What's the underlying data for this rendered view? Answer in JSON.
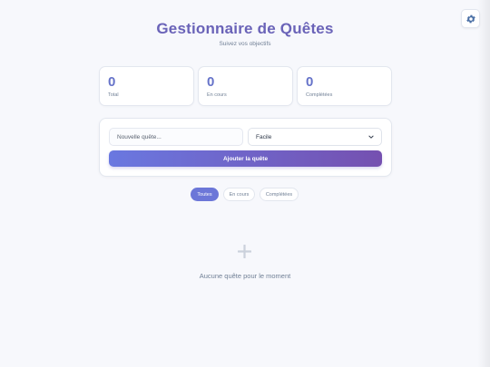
{
  "header": {
    "title": "Gestionnaire de Quêtes",
    "subtitle": "Suivez vos objectifs"
  },
  "settings": {
    "icon": "gear-icon"
  },
  "stats": [
    {
      "value": "0",
      "label": "Total"
    },
    {
      "value": "0",
      "label": "En cours"
    },
    {
      "value": "0",
      "label": "Complétées"
    }
  ],
  "form": {
    "input_placeholder": "Nouvelle quête...",
    "input_value": "",
    "difficulty_selected": "Facile",
    "add_button_label": "Ajouter la quête"
  },
  "filters": [
    {
      "label": "Toutes",
      "active": true
    },
    {
      "label": "En cours",
      "active": false
    },
    {
      "label": "Complétées",
      "active": false
    }
  ],
  "empty_state": {
    "icon": "plus-icon",
    "text": "Aucune quête pour le moment"
  },
  "colors": {
    "accent": "#6c77d8",
    "title": "#6a63b8",
    "button_gradient_start": "#6a78e0",
    "button_gradient_end": "#7550b0",
    "background": "#f7f8fc"
  }
}
